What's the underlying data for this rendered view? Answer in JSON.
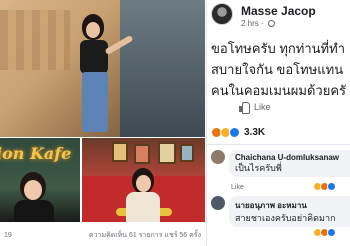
{
  "photo_post": {
    "cafe_sign": "ion Kafe",
    "footer_left": "19",
    "footer_right_label": "ความคิดเห็น 61 รายการ แชร์ 56 ครั้ง"
  },
  "fb_post": {
    "author": "Masse Jacop",
    "time": "2 hrs",
    "text_lines": [
      "ขอโทษครับ ทุกท่านที่ทำ",
      "สบายใจกัน ขอโทษแทน",
      "คนในคอมเมนผมด้วยครั"
    ],
    "like_label": "Like",
    "reaction_count": "3.3K",
    "comments": [
      {
        "name": "Chaichana U-domluksanaw",
        "text": "เป็นไรครับพี่"
      },
      {
        "name": "นายอนุภาพ อะหมาน",
        "text": "สายชาเองครับอย่าคิดมาก"
      }
    ],
    "comment_like_label": "Like"
  },
  "colors": {
    "fb_blue": "#1877f2",
    "angry": "#e9710f",
    "haha": "#f7b125",
    "text": "#1c1e21",
    "muted": "#65676b"
  },
  "icons": {
    "like": "thumbs-up-icon",
    "privacy": "globe-icon"
  }
}
